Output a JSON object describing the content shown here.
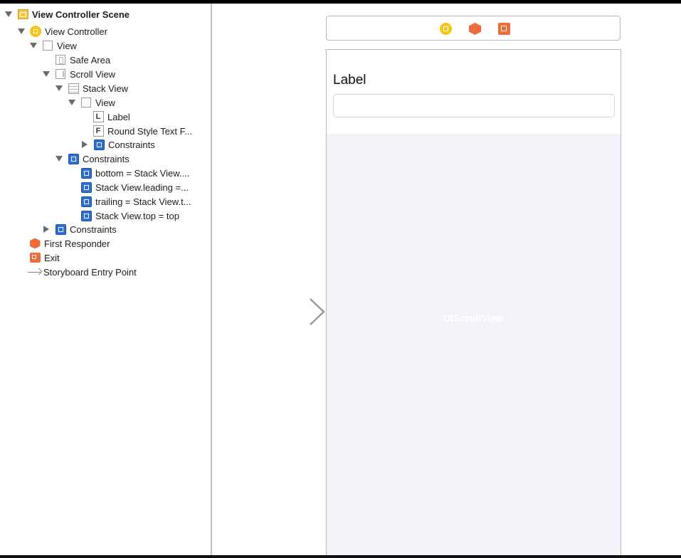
{
  "outline": {
    "items": [
      {
        "label": "View Controller Scene",
        "icon": "scene-icon"
      },
      {
        "label": "View Controller",
        "icon": "view-controller-icon"
      },
      {
        "label": "View",
        "icon": "view-icon"
      },
      {
        "label": "Safe Area",
        "icon": "safe-area-icon"
      },
      {
        "label": "Scroll View",
        "icon": "scroll-view-icon"
      },
      {
        "label": "Stack View",
        "icon": "stack-view-icon"
      },
      {
        "label": "View",
        "icon": "view-icon"
      },
      {
        "label": "Label",
        "icon": "label-icon",
        "icon_text": "L"
      },
      {
        "label": "Round Style Text F...",
        "icon": "text-field-icon",
        "icon_text": "F"
      },
      {
        "label": "Constraints",
        "icon": "constraints-icon"
      },
      {
        "label": "Constraints",
        "icon": "constraints-icon"
      },
      {
        "label": "bottom = Stack View....",
        "icon": "constraint-icon"
      },
      {
        "label": "Stack View.leading =...",
        "icon": "constraint-icon"
      },
      {
        "label": "trailing = Stack View.t...",
        "icon": "constraint-icon"
      },
      {
        "label": "Stack View.top = top",
        "icon": "constraint-icon"
      },
      {
        "label": "Constraints",
        "icon": "constraints-icon"
      },
      {
        "label": "First Responder",
        "icon": "first-responder-icon"
      },
      {
        "label": "Exit",
        "icon": "exit-icon"
      },
      {
        "label": "Storyboard Entry Point",
        "icon": "entry-point-icon"
      }
    ]
  },
  "canvas": {
    "dock_icons": [
      "view-controller-icon",
      "first-responder-icon",
      "exit-icon"
    ],
    "label_text": "Label",
    "text_field_value": "",
    "scroll_view_label": "UIScrollView"
  },
  "colors": {
    "accent_yellow": "#f5c518",
    "accent_orange": "#ee6b3c",
    "constraint_blue": "#2d6fd6",
    "scroll_bg": "#f2f3f8"
  }
}
